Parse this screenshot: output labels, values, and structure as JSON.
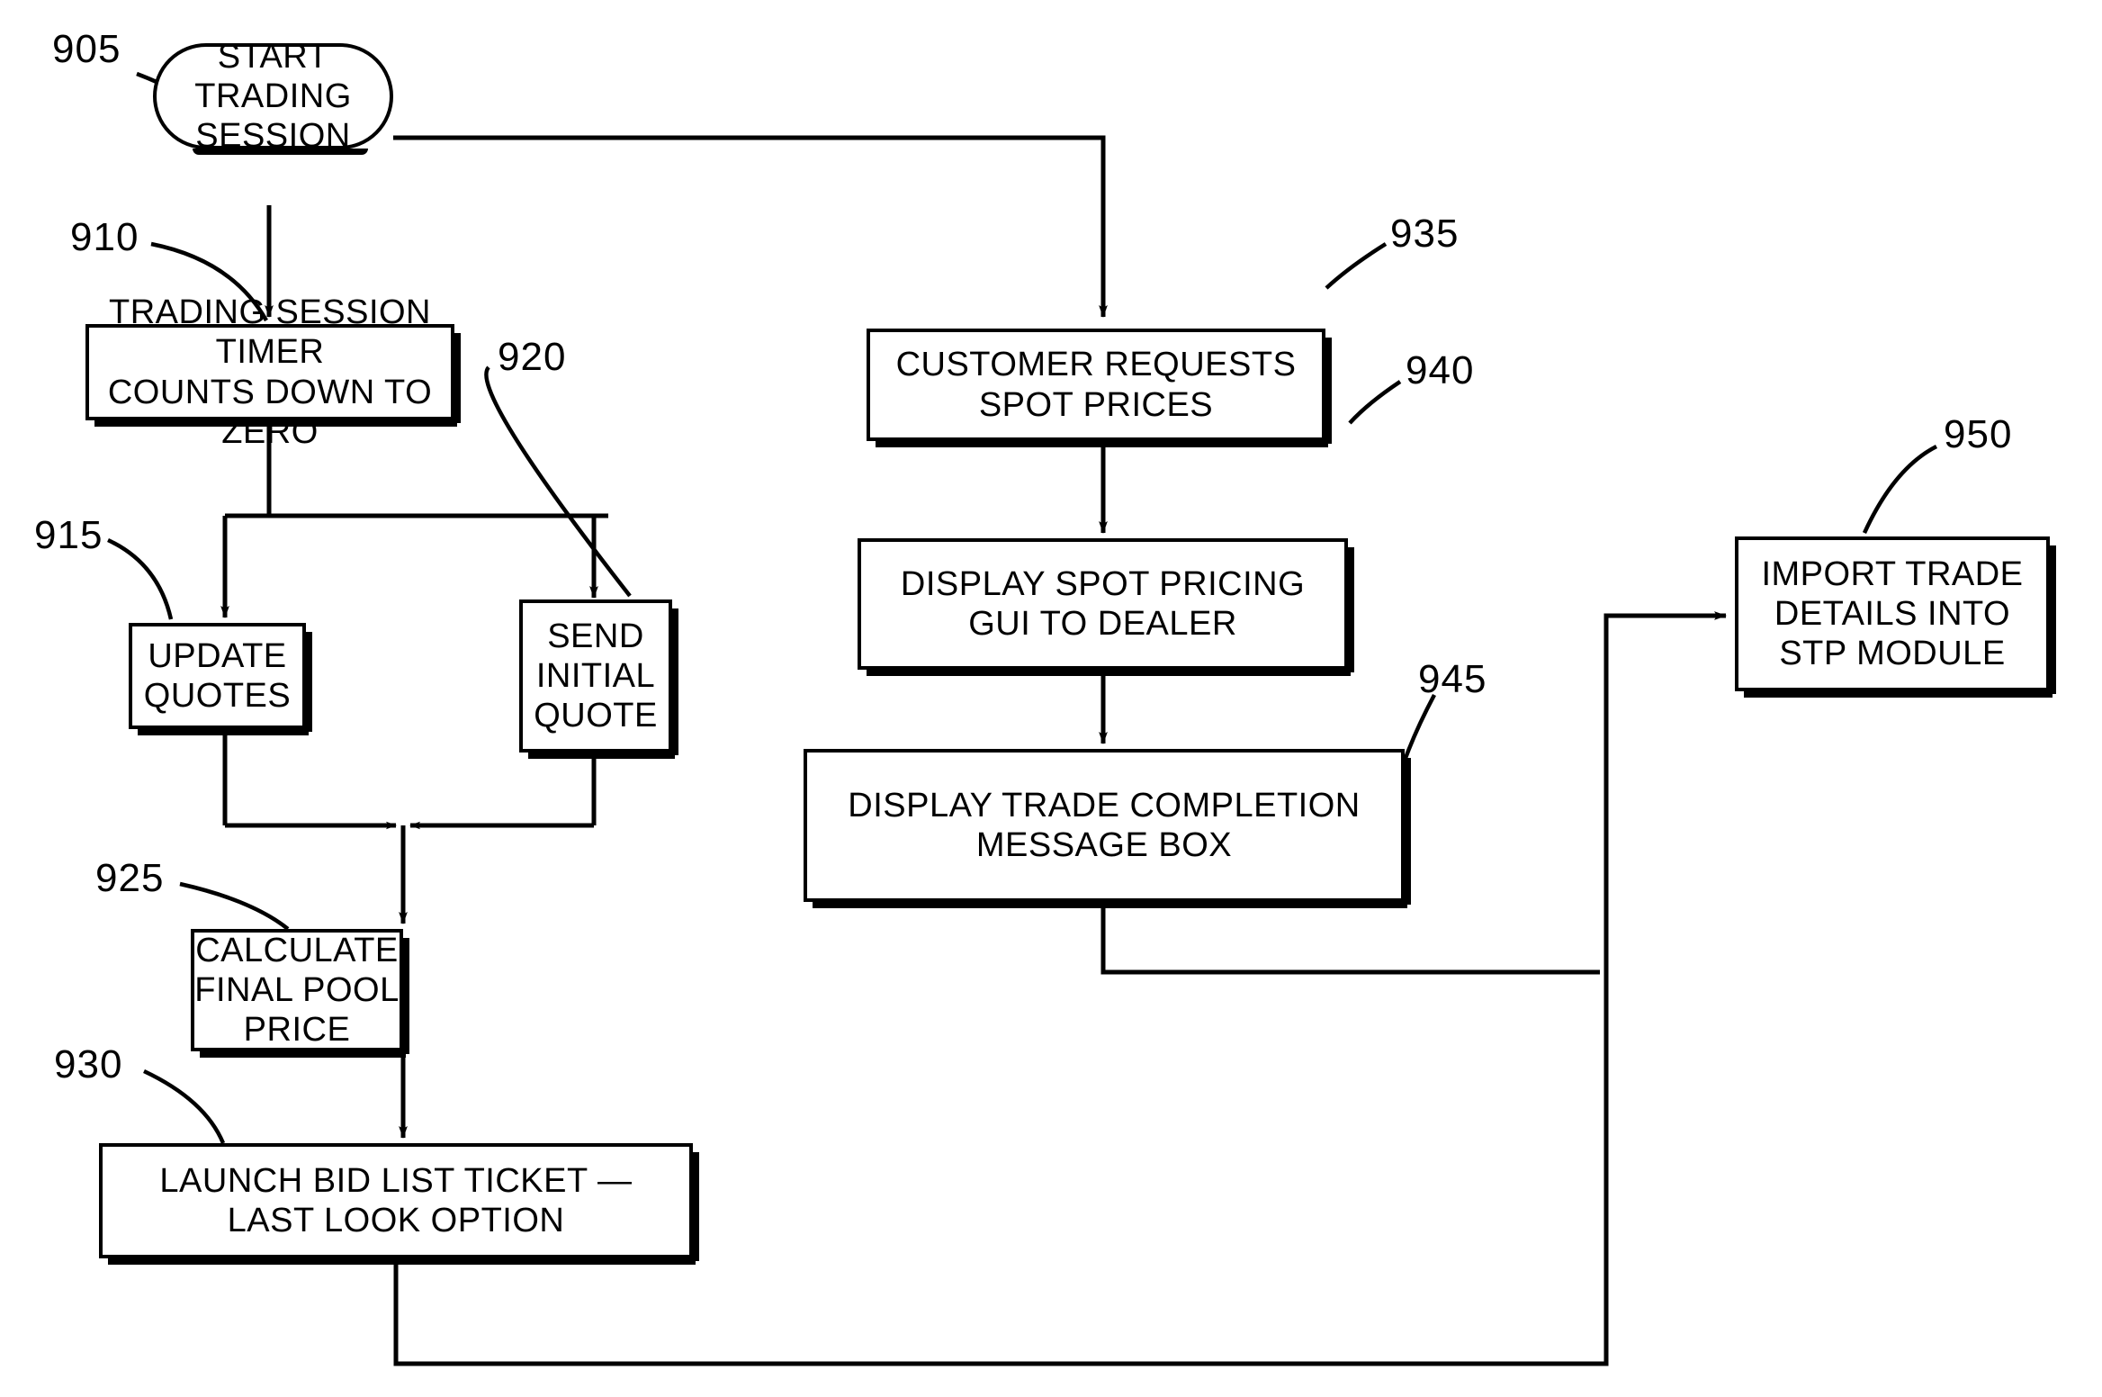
{
  "figure": {
    "type": "flowchart",
    "orientation": "left-to-right columns with feedback loops",
    "background": "#ffffff",
    "ink": "#000000"
  },
  "nodes": [
    {
      "id": "905",
      "ref": "905",
      "shape": "terminator",
      "text": "START\nTRADING\nSESSION"
    },
    {
      "id": "910",
      "ref": "910",
      "shape": "process",
      "text": "TRADING  SESSION  TIMER\nCOUNTS  DOWN  TO  ZERO"
    },
    {
      "id": "915",
      "ref": "915",
      "shape": "process",
      "text": "UPDATE\nQUOTES"
    },
    {
      "id": "920",
      "ref": "920",
      "shape": "process",
      "text": "SEND\nINITIAL\nQUOTE"
    },
    {
      "id": "925",
      "ref": "925",
      "shape": "process",
      "text": "CALCULATE\nFINAL  POOL  PRICE"
    },
    {
      "id": "930",
      "ref": "930",
      "shape": "process",
      "text": "LAUNCH  BID  LIST  TICKET  —\nLAST  LOOK  OPTION"
    },
    {
      "id": "935",
      "ref": "935",
      "shape": "process",
      "text": "CUSTOMER  REQUESTS\nSPOT  PRICES"
    },
    {
      "id": "940",
      "ref": "940",
      "shape": "process",
      "text": "DISPLAY  SPOT  PRICING\nGUI  TO  DEALER"
    },
    {
      "id": "945",
      "ref": "945",
      "shape": "process",
      "text": "DISPLAY  TRADE  COMPLETION\nMESSAGE  BOX"
    },
    {
      "id": "950",
      "ref": "950",
      "shape": "process",
      "text": "IMPORT  TRADE\nDETAILS  INTO\nSTP  MODULE"
    }
  ],
  "reference_numerals": [
    "905",
    "910",
    "915",
    "920",
    "925",
    "930",
    "935",
    "940",
    "945",
    "950"
  ],
  "edges": [
    {
      "from": "905",
      "to": "910",
      "style": "straight-down-arrow"
    },
    {
      "from": "905",
      "to": "935",
      "style": "right-then-down-arrow"
    },
    {
      "from": "910",
      "to": "915",
      "style": "split-left-down-arrow"
    },
    {
      "from": "910",
      "to": "920",
      "style": "split-right-down-arrow"
    },
    {
      "from": "915",
      "to": "925",
      "style": "down-merge-arrow"
    },
    {
      "from": "920",
      "to": "925",
      "style": "down-merge-arrow"
    },
    {
      "from": "925",
      "to": "930",
      "style": "straight-down-arrow"
    },
    {
      "from": "930",
      "to": "950",
      "style": "down-right-up-arrow"
    },
    {
      "from": "935",
      "to": "940",
      "style": "straight-down-arrow"
    },
    {
      "from": "940",
      "to": "945",
      "style": "straight-down-arrow"
    },
    {
      "from": "945",
      "to": "950",
      "style": "down-right-up-arrow"
    }
  ]
}
